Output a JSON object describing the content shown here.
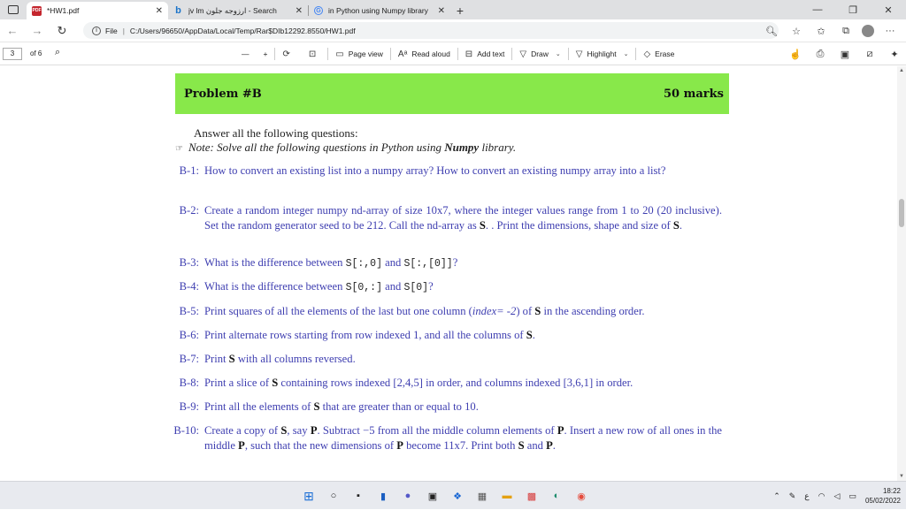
{
  "browser": {
    "tabs": [
      {
        "label": "*HW1.pdf",
        "icon": "pdf-icon",
        "active": true
      },
      {
        "label": "jv lm ﺍﺭﺯﻭﺟﻪ ﺟﻠﻮﻥ - Search",
        "icon": "bing-icon",
        "active": false
      },
      {
        "label": "in Python using Numpy library",
        "icon": "google-icon",
        "active": false
      }
    ],
    "url_prefix": "File",
    "url": "C:/Users/96650/AppData/Local/Temp/Rar$DIb12292.8550/HW1.pdf"
  },
  "pdf_toolbar": {
    "page_current": "3",
    "page_total": "of 6",
    "minus": "—",
    "plus": "+",
    "page_view": "Page view",
    "read_aloud": "Read aloud",
    "add_text": "Add text",
    "draw": "Draw",
    "highlight": "Highlight",
    "erase": "Erase"
  },
  "document": {
    "problem_title": "Problem #B",
    "problem_marks": "50 marks",
    "intro": "Answer all the following questions:",
    "note_prefix": "Note: Solve all the following questions in Python using ",
    "note_lib": "Numpy",
    "note_suffix": " library.",
    "questions": [
      {
        "num": "B-1:",
        "text": "How to convert an existing list into a numpy array? How to convert an existing numpy array into a list?"
      },
      {
        "num": "B-2:",
        "a": "Create a random integer numpy nd-array of size 10x7, where the integer values range from 1 to 20 (20 inclusive). Set the random generator seed to be 212. Call the nd-array as ",
        "b": "S",
        "c": ". . Print the dimensions, shape and size of ",
        "d": "S",
        "e": "."
      },
      {
        "num": "B-3:",
        "a": "What is the difference between ",
        "m1": "S[:,0]",
        "b": " and ",
        "m2": "S[:,[0]]",
        "c": "?"
      },
      {
        "num": "B-4:",
        "a": "What is the difference between ",
        "m1": "S[0,:]",
        "b": " and ",
        "m2": "S[0]",
        "c": "?"
      },
      {
        "num": "B-5:",
        "a": "Print squares of all the elements of the last but one column (",
        "i": "index= -2",
        "b": ") of ",
        "s": "S",
        "c": " in the ascending order."
      },
      {
        "num": "B-6:",
        "a": "Print alternate rows starting from row indexed 1, and all the columns of ",
        "s": "S",
        "c": "."
      },
      {
        "num": "B-7:",
        "a": "Print ",
        "s": "S",
        "c": " with all columns reversed."
      },
      {
        "num": "B-8:",
        "a": "Print a slice of ",
        "s": "S",
        "c": " containing rows indexed [2,4,5] in order, and columns indexed [3,6,1] in order."
      },
      {
        "num": "B-9:",
        "a": "Print all the elements of ",
        "s": "S",
        "c": " that are greater than or equal to 10."
      },
      {
        "num": "B-10:",
        "a": "Create a copy of ",
        "s1": "S",
        "b": ", say ",
        "p1": "P",
        "c": ". Subtract −5 from all the middle column elements of ",
        "p2": "P",
        "d": ". Insert a new row of all ones in the middle ",
        "p3": "P",
        "e": ", such that the new dimensions of ",
        "p4": "P",
        "f": " become 11x7. Print both ",
        "s2": "S",
        "g": " and ",
        "p5": "P",
        "h": "."
      }
    ]
  },
  "taskbar": {
    "time": "18:22",
    "date": "05/02/2022"
  }
}
